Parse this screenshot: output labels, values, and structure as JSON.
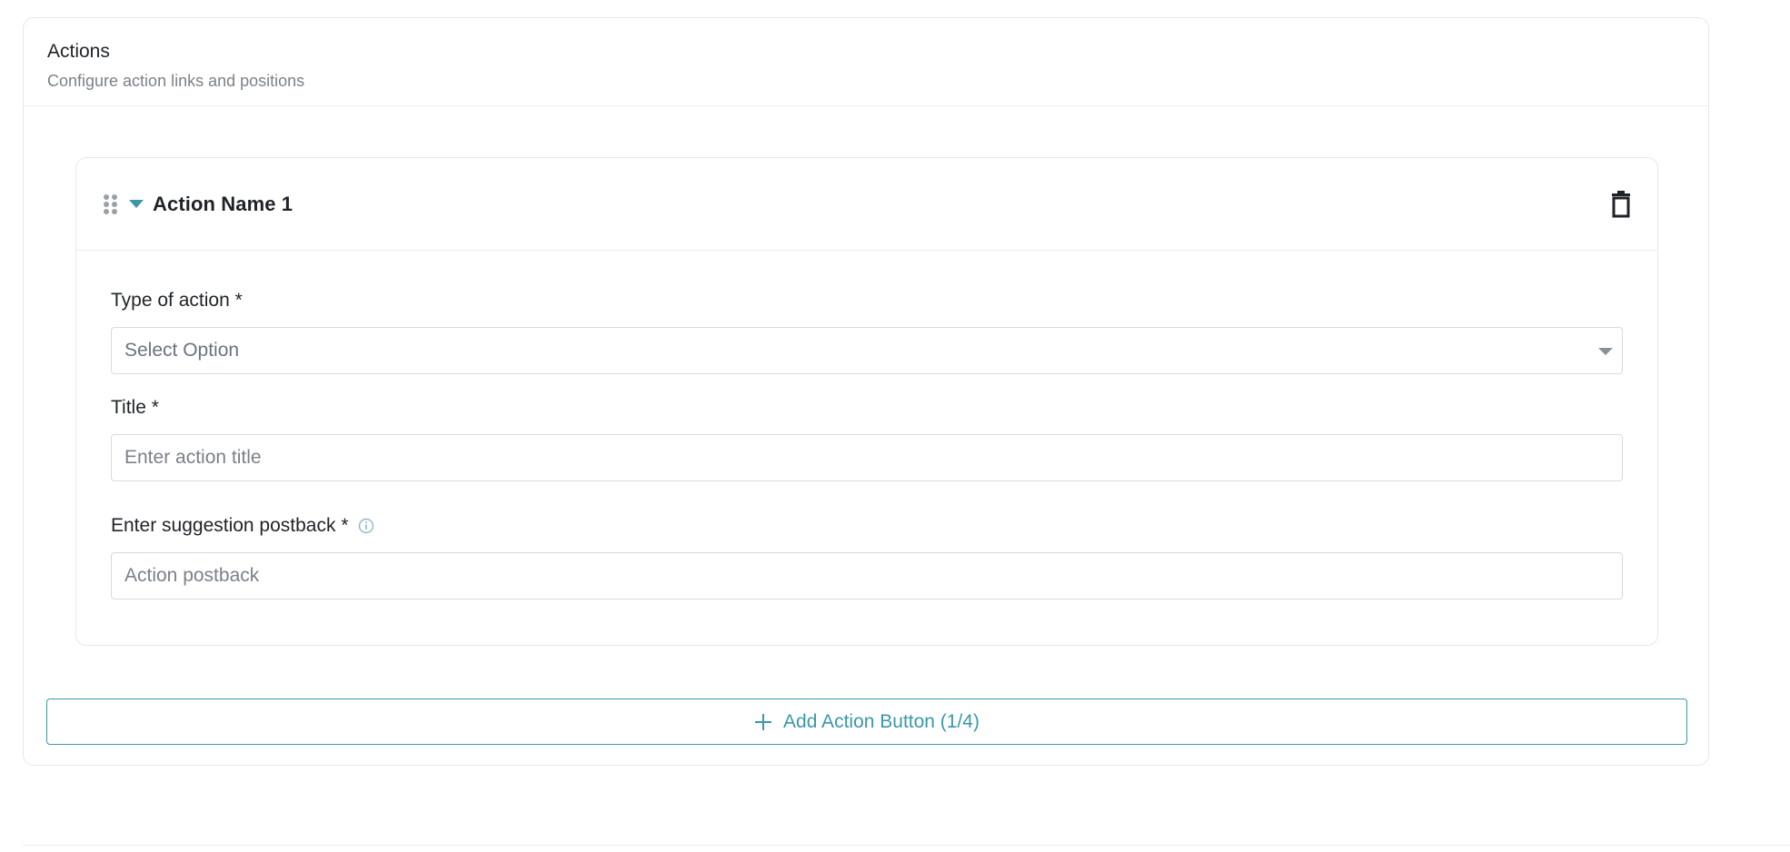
{
  "panel": {
    "title": "Actions",
    "subtitle": "Configure action links and positions"
  },
  "action_card": {
    "title": "Action Name 1",
    "fields": {
      "type": {
        "label": "Type of action *",
        "placeholder": "Select Option"
      },
      "title": {
        "label": "Title *",
        "placeholder": "Enter action title"
      },
      "postback": {
        "label": "Enter suggestion postback *",
        "placeholder": "Action postback"
      }
    }
  },
  "add_button": {
    "label": "Add Action Button (1/4)"
  },
  "colors": {
    "accent": "#3a98a8",
    "border": "#e6e8eb",
    "muted": "#7b8189"
  },
  "icons": [
    "drag-handle-icon",
    "caret-down-icon",
    "trash-icon",
    "chevron-down-icon",
    "info-icon",
    "plus-icon"
  ]
}
